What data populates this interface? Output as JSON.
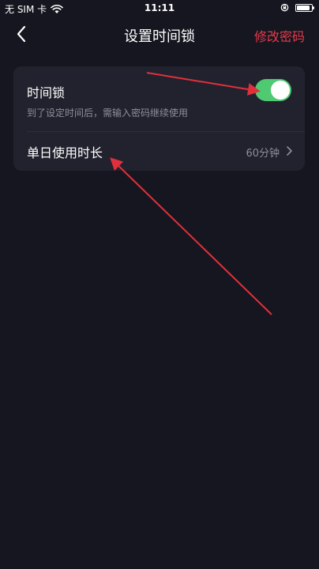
{
  "status_bar": {
    "carrier": "无 SIM 卡",
    "time": "11:11",
    "battery_level": 0.9
  },
  "nav": {
    "title": "设置时间锁",
    "action": "修改密码",
    "back_icon": "chevron-left-icon"
  },
  "settings": {
    "time_lock": {
      "title": "时间锁",
      "description": "到了设定时间后，需输入密码继续使用",
      "enabled": true
    },
    "daily_duration": {
      "title": "单日使用时长",
      "value": "60分钟"
    }
  },
  "colors": {
    "background": "#15161f",
    "card": "#21222d",
    "accent_red": "#e33b4c",
    "toggle_on": "#4fc972",
    "secondary_text": "#8e8f99",
    "annotation_arrow": "#e0303c"
  }
}
